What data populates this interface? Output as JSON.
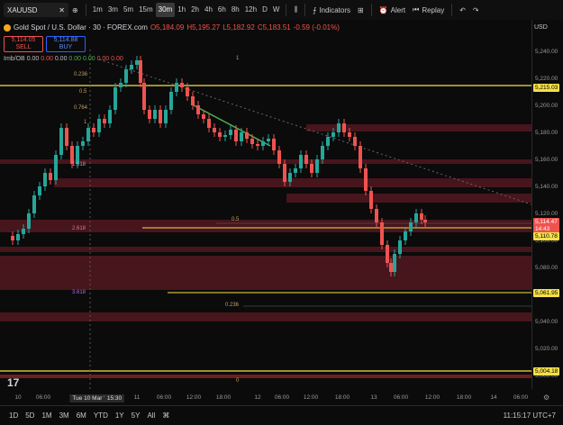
{
  "toolbar": {
    "symbol": "XAUUSD",
    "timeframes": [
      "1m",
      "3m",
      "5m",
      "15m",
      "30m",
      "1h",
      "2h",
      "4h",
      "6h",
      "8h",
      "12h",
      "D",
      "W"
    ],
    "active_timeframe": "30m",
    "indicators_label": "Indicators",
    "alert_label": "Alert",
    "replay_label": "Replay"
  },
  "legend": {
    "title": "Gold Spot / U.S. Dollar · 30 · FOREX.com",
    "o": "O5,184.09",
    "h": "H5,195.27",
    "l": "L5,182.92",
    "c": "C5,183.51",
    "chg": "-0.59 (-0.01%)",
    "sell_price": "5,114.05",
    "sell_label": "SELL",
    "buy_price": "5,114.88",
    "buy_label": "BUY",
    "imb_label": "Imb/OB",
    "imb_values": [
      "0.00",
      "0.00",
      "0.00",
      "0.00",
      "0.00",
      "0.00",
      "0.00"
    ]
  },
  "fib_labels": {
    "f1_top": "1",
    "f0236": "0.236",
    "f05": "0.5",
    "f0764": "0.764",
    "f1": "1",
    "f1618": "1.618",
    "f2618": "2.618",
    "f3618": "3.618",
    "f05b": "0.5",
    "f0236b": "0.236",
    "f0": "0"
  },
  "y_axis": [
    "5,240.00",
    "5,220.00",
    "5,200.00",
    "5,180.00",
    "5,160.00",
    "5,140.00",
    "5,120.00",
    "5,100.00",
    "5,080.00",
    "5,060.00",
    "5,040.00",
    "5,020.00",
    "5,000.00"
  ],
  "price_tags": {
    "top_line": "5,215.03",
    "current": "5,114.47",
    "countdown": "14:43",
    "mid_line": "5,110.78",
    "low_line": "5,061.95",
    "bottom_line": "5,004.18"
  },
  "currency": "USD",
  "x_axis": [
    "10",
    "06:00",
    "Tue 10 Mar '26",
    "15:30",
    "11",
    "06:00",
    "12:00",
    "18:00",
    "12",
    "06:00",
    "12:00",
    "18:00",
    "13",
    "06:00",
    "12:00",
    "18:00",
    "14",
    "06:00"
  ],
  "bottom": {
    "ranges": [
      "1D",
      "5D",
      "1M",
      "3M",
      "6M",
      "YTD",
      "1Y",
      "5Y",
      "All"
    ],
    "clock": "11:15:17 UTC+7"
  },
  "colors": {
    "up": "#26a69a",
    "down": "#ef5350",
    "zone": "#7a1f2b",
    "yellow_line": "#f5e04a"
  }
}
